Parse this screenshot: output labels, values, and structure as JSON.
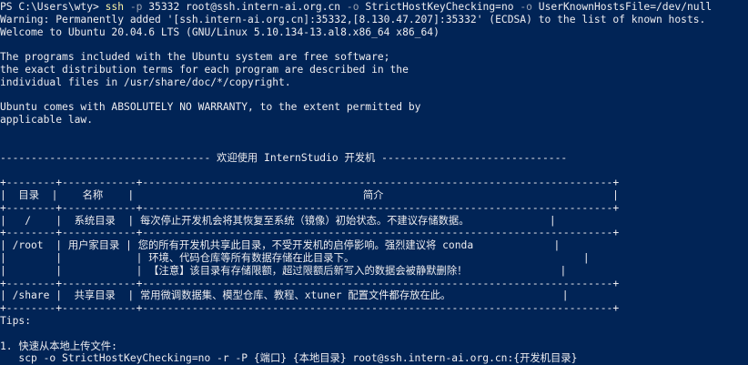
{
  "colors": {
    "background": "#012456",
    "foreground": "#eeedf0",
    "command": "#f9f1a5",
    "option": "#9aa2b0"
  },
  "prompt": {
    "ps_prefix": "PS C:\\Users\\wty> ",
    "command": "ssh",
    "seg1": " ",
    "opt_p": "-p",
    "seg2": " 35332 root@ssh.intern-ai.org.cn ",
    "opt_o1": "-o",
    "seg3": " StrictHostKeyChecking=no ",
    "opt_o2": "-o",
    "seg4": " UserKnownHostsFile=/dev/null"
  },
  "output": {
    "warning": "Warning: Permanently added '[ssh.intern-ai.org.cn]:35332,[8.130.47.207]:35332' (ECDSA) to the list of known hosts.",
    "welcome": "Welcome to Ubuntu 20.04.6 LTS (GNU/Linux 5.10.134-13.al8.x86_64 x86_64)",
    "blank": "",
    "free_1": "The programs included with the Ubuntu system are free software;",
    "free_2": "the exact distribution terms for each program are described in the",
    "free_3": "individual files in /usr/share/doc/*/copyright.",
    "warranty_1": "Ubuntu comes with ABSOLUTELY NO WARRANTY, to the extent permitted by",
    "warranty_2": "applicable law.",
    "banner": "---------------------------------- 欢迎使用 InternStudio 开发机 ------------------------------",
    "table_border": "+--------+------------+----------------------------------------------------------------------------+",
    "table_header": "|  目录  |    名称    |                                     简介                                     |",
    "table_row_root_dir": "|   /    |  系统目录  | 每次停止开发机会将其恢复至系统（镜像）初始状态。不建议存储数据。             |",
    "table_row_home_1": "| /root  | 用户家目录 | 您的所有开发机共享此目录，不受开发机的启停影响。强烈建议将 conda             |",
    "table_row_home_2": "|        |            | 环境、代码仓库等所有数据存储在此目录下。                                     |",
    "table_row_home_3": "|        |            | 【注意】该目录有存储限额，超过限额后新写入的数据会被静默删除！               |",
    "table_row_share": "| /share |  共享目录  | 常用微调数据集、模型仓库、教程、xtuner 配置文件都存放在此。                  |",
    "tips": "Tips:",
    "tip_1": "1. 快速从本地上传文件:",
    "tip_1_cmd": "   scp -o StrictHostKeyChecking=no -r -P {端口} {本地目录} root@ssh.intern-ai.org.cn:{开发机目录}"
  }
}
